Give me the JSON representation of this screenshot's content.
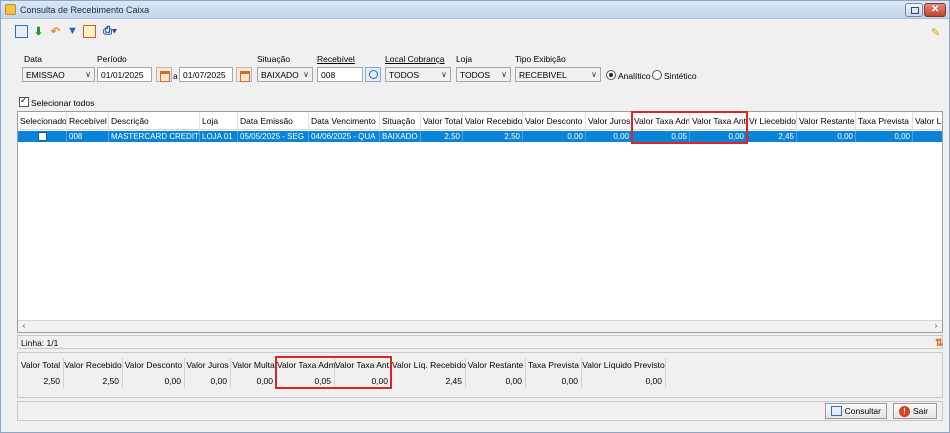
{
  "window": {
    "title": "Consulta de Recebimento Caixa"
  },
  "filters": {
    "data_label": "Data",
    "data_value": "EMISSAO",
    "periodo_label": "Período",
    "periodo_from": "01/01/2025",
    "periodo_sep": "a",
    "periodo_to": "01/07/2025",
    "situacao_label": "Situação",
    "situacao_value": "BAIXADO",
    "recebivel_label": "Recebível",
    "recebivel_value": "008",
    "local_label": "Local Cobrança",
    "local_value": "TODOS",
    "loja_label": "Loja",
    "loja_value": "TODOS",
    "tipo_label": "Tipo Exibição",
    "tipo_value": "RECEBIVEL",
    "radio_analitico": "Analítico",
    "radio_sintetico": "Sintético",
    "selecionar_todos": "Selecionar todos"
  },
  "grid": {
    "columns": [
      "Selecionado",
      "Recebível",
      "Descrição",
      "Loja",
      "Data Emissão",
      "Data Vencimento",
      "Situação",
      "Valor Total",
      "Valor Recebido",
      "Valor Desconto",
      "Valor Juros",
      "Valor Taxa Adm.",
      "Valor Taxa Ant.",
      "Vr Liecebido",
      "Valor Restante",
      "Taxa Prevista",
      "Valor Líq"
    ],
    "rows": [
      {
        "recebivel": "008",
        "descricao": "MASTERCARD CREDITO",
        "loja": "LOJA 01",
        "data_emissao": "05/05/2025 - SEG",
        "data_vencimento": "04/06/2025 - QUA",
        "situacao": "BAIXADO",
        "valor_total": "2,50",
        "valor_recebido": "2,50",
        "valor_desconto": "0,00",
        "valor_juros": "0,00",
        "valor_taxa_adm": "0,05",
        "valor_taxa_ant": "0,00",
        "vr_liq_recebido": "2,45",
        "valor_restante": "0,00",
        "taxa_prevista": "0,00"
      }
    ]
  },
  "status": {
    "linha": "Linha: 1/1"
  },
  "totals": {
    "labels": [
      "Valor Total",
      "Valor Recebido",
      "Valor Desconto",
      "Valor Juros",
      "Valor Multa",
      "Valor Taxa Adm.",
      "Valor Taxa Ant.",
      "Valor Líq. Recebido",
      "Valor Restante",
      "Taxa Prevista",
      "Valor Líquido Previsto"
    ],
    "values": [
      "2,50",
      "2,50",
      "0,00",
      "0,00",
      "0,00",
      "0,05",
      "0,00",
      "2,45",
      "0,00",
      "0,00",
      "0,00"
    ]
  },
  "buttons": {
    "consultar": "Consultar",
    "sair": "Sair"
  },
  "colors": {
    "selection": "#0a84d8",
    "highlight": "#e02424"
  },
  "icons": [
    "search-icon",
    "download-icon",
    "undo-icon",
    "filter-icon",
    "edit-icon",
    "print-icon",
    "magic-wand-icon",
    "calendar-icon",
    "sort-icon",
    "exit-icon"
  ]
}
